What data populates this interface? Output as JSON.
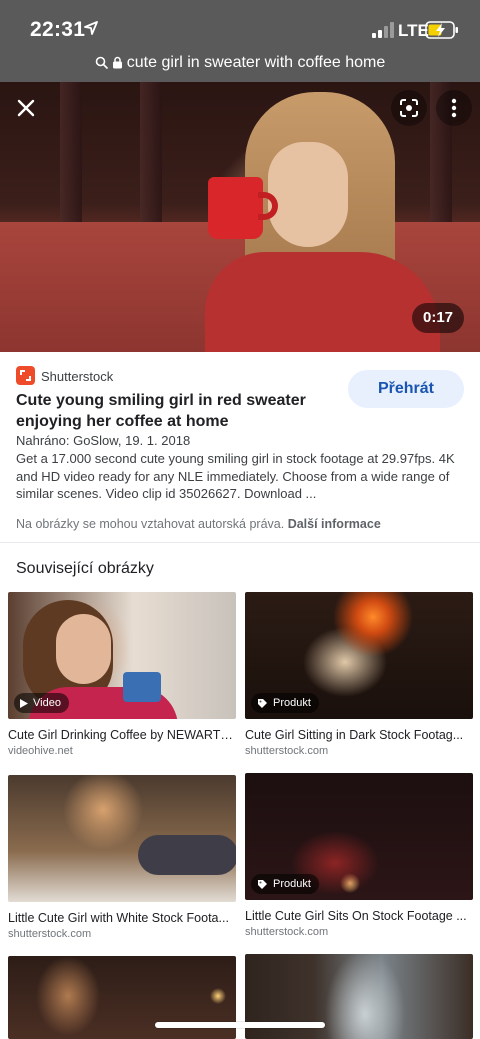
{
  "status_bar": {
    "time": "22:31",
    "network": "LTE"
  },
  "url_bar": {
    "query": "cute girl in sweater with coffee home"
  },
  "video": {
    "duration": "0:17"
  },
  "result": {
    "source": "Shutterstock",
    "play_label": "Přehrát",
    "title": "Cute young smiling girl in red sweater enjoying her coffee at home",
    "uploaded": "Nahráno: GoSlow, 19. 1. 2018",
    "description": "Get a 17.000 second cute young smiling girl in stock footage at 29.97fps. 4K and HD video ready for any NLE immediately. Choose from a wide range of similar scenes. Video clip id 35026627. Download ...",
    "copyright_text": "Na obrázky se mohou vztahovat autorská práva.",
    "more_info_link": "Další informace"
  },
  "related": {
    "heading": "Související obrázky",
    "items": [
      {
        "title": "Cute Girl Drinking Coffee by NEWARTI...",
        "source": "videohive.net",
        "badge": "Video"
      },
      {
        "title": "Cute Girl Sitting in Dark Stock Footag...",
        "source": "shutterstock.com",
        "badge": "Produkt"
      },
      {
        "title": "Little Cute Girl with White Stock Foota...",
        "source": "shutterstock.com",
        "badge": ""
      },
      {
        "title": "Little Cute Girl Sits On Stock Footage ...",
        "source": "shutterstock.com",
        "badge": "Produkt"
      }
    ]
  },
  "colors": {
    "accent": "#1a56b0",
    "play_bg": "#e8f0fe",
    "source_logo": "#ee4b2b",
    "status_bg": "#5a5a5a"
  }
}
